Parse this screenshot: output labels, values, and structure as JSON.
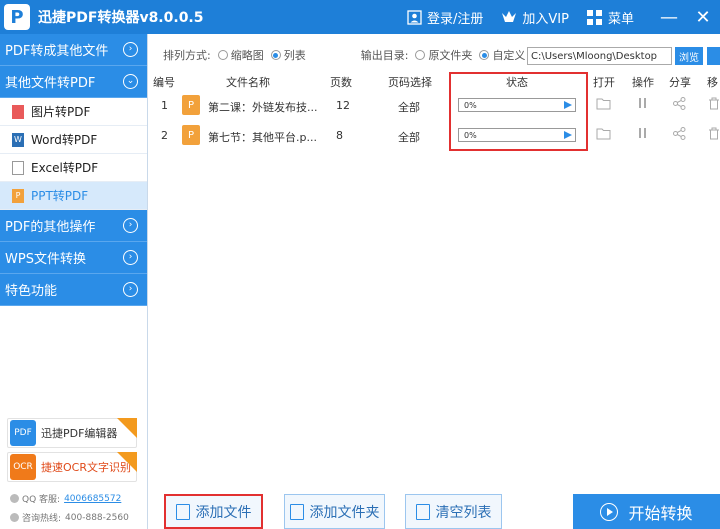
{
  "titlebar": {
    "title": "迅捷PDF转换器v8.0.0.5",
    "login": "登录/注册",
    "vip": "加入VIP",
    "menu": "菜单",
    "min": "—",
    "close": "✕"
  },
  "sidebar": {
    "cat1": "PDF转成其他文件",
    "cat2": "其他文件转PDF",
    "subs": [
      "图片转PDF",
      "Word转PDF",
      "Excel转PDF",
      "PPT转PDF"
    ],
    "cat3": "PDF的其他操作",
    "cat4": "WPS文件转换",
    "cat5": "特色功能",
    "promo1": "迅捷PDF编辑器",
    "promo2": "捷速OCR文字识别",
    "qq_label": "QQ 客服:",
    "qq": "4006685572",
    "phone_label": "咨询热线:",
    "phone": "400-888-2560"
  },
  "toolbar": {
    "sort_label": "排列方式:",
    "thumb": "缩略图",
    "list": "列表",
    "out_label": "输出目录:",
    "orig": "原文件夹",
    "custom": "自定义",
    "path": "C:\\Users\\Mloong\\Desktop",
    "browse": "浏览"
  },
  "table": {
    "headers": {
      "no": "编号",
      "name": "文件名称",
      "pages": "页数",
      "select": "页码选择",
      "status": "状态",
      "open": "打开",
      "op": "操作",
      "share": "分享",
      "move": "移"
    },
    "rows": [
      {
        "no": "1",
        "icon": "P",
        "name": "第二课：外链发布技...",
        "pages": "12",
        "select": "全部",
        "progress": "0%"
      },
      {
        "no": "2",
        "icon": "P",
        "name": "第七节：其他平台.p...",
        "pages": "8",
        "select": "全部",
        "progress": "0%"
      }
    ]
  },
  "bottom": {
    "add_file": "添加文件",
    "add_folder": "添加文件夹",
    "clear": "清空列表",
    "start": "开始转换"
  }
}
